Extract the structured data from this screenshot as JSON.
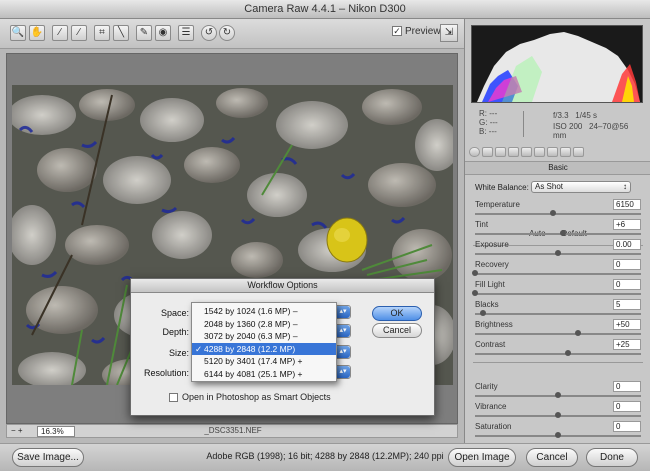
{
  "window": {
    "title": "Camera Raw 4.4.1  –  Nikon D300"
  },
  "toolbar": {
    "tools": [
      "zoom-icon",
      "hand-icon",
      "white-balance-icon",
      "color-sampler-icon",
      "crop-icon",
      "straighten-icon",
      "retouch-icon",
      "red-eye-icon",
      "preferences-icon",
      "rotate-ccw-icon",
      "rotate-cw-icon"
    ],
    "preview_label": "Preview",
    "preview_checked": true
  },
  "histogram": {
    "r_label": "R:",
    "g_label": "G:",
    "b_label": "B:",
    "r_value": "---",
    "g_value": "---",
    "b_value": "---",
    "aperture": "f/3.3",
    "shutter": "1/45 s",
    "iso": "ISO 200",
    "lens": "24–70@56 mm"
  },
  "panel": {
    "title": "Basic",
    "white_balance_label": "White Balance:",
    "white_balance_value": "As Shot",
    "auto_label": "Auto",
    "default_label": "Default",
    "controls": [
      {
        "label": "Temperature",
        "value": "6150",
        "level": 0.47
      },
      {
        "label": "Tint",
        "value": "+6",
        "level": 0.53
      },
      {
        "label": "Exposure",
        "value": "0.00",
        "level": 0.5
      },
      {
        "label": "Recovery",
        "value": "0",
        "level": 0.0
      },
      {
        "label": "Fill Light",
        "value": "0",
        "level": 0.0
      },
      {
        "label": "Blacks",
        "value": "5",
        "level": 0.05
      },
      {
        "label": "Brightness",
        "value": "+50",
        "level": 0.62
      },
      {
        "label": "Contrast",
        "value": "+25",
        "level": 0.56
      },
      {
        "label": "Clarity",
        "value": "0",
        "level": 0.5
      },
      {
        "label": "Vibrance",
        "value": "0",
        "level": 0.5
      },
      {
        "label": "Saturation",
        "value": "0",
        "level": 0.5
      }
    ]
  },
  "image_area": {
    "zoom_value": "16.3%",
    "filename": "_DSC3351.NEF"
  },
  "footer": {
    "save_label": "Save Image...",
    "workflow_link": "Adobe RGB (1998); 16 bit; 4288 by 2848 (12.2MP); 240 ppi",
    "open_label": "Open Image",
    "cancel_label": "Cancel",
    "done_label": "Done"
  },
  "dialog": {
    "title": "Workflow Options",
    "space_label": "Space:",
    "depth_label": "Depth:",
    "size_label": "Size:",
    "resolution_label": "Resolution:",
    "ok_label": "OK",
    "cancel_label": "Cancel",
    "smart_objects_label": "Open in Photoshop as Smart Objects",
    "smart_objects_checked": false,
    "size_options": [
      {
        "label": "1542 by 1024  (1.6 MP)  –",
        "selected": false
      },
      {
        "label": "2048 by 1360  (2.8 MP)  –",
        "selected": false
      },
      {
        "label": "3072 by 2040  (6.3 MP)  –",
        "selected": false
      },
      {
        "label": "4288 by 2848  (12.2 MP)",
        "selected": true
      },
      {
        "label": "5120 by 3401  (17.4 MP)  +",
        "selected": false
      },
      {
        "label": "6144 by 4081  (25.1 MP)  +",
        "selected": false
      }
    ]
  }
}
